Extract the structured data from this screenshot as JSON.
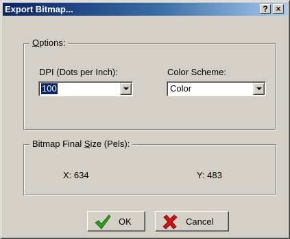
{
  "window": {
    "title": "Export Bitmap...",
    "help_label": "?",
    "close_label": "×"
  },
  "options": {
    "group_label_prefix": "",
    "group_label_accel": "O",
    "group_label_rest": "ptions:",
    "dpi_label": "DPI (Dots per Inch):",
    "dpi_value": "100",
    "color_scheme_label": "Color Scheme:",
    "color_scheme_value": "Color"
  },
  "bitmap_size": {
    "group_label_prefix": "Bitmap Final ",
    "group_label_accel": "S",
    "group_label_rest": "ize (Pels):",
    "x_text": "X: 634",
    "y_text": "Y: 483"
  },
  "buttons": {
    "ok_label": "OK",
    "cancel_label": "Cancel"
  },
  "icons": {
    "ok_icon": "green-checkmark-icon",
    "cancel_icon": "red-x-icon",
    "check_color": "#2e9e1f",
    "x_color": "#d41010"
  }
}
